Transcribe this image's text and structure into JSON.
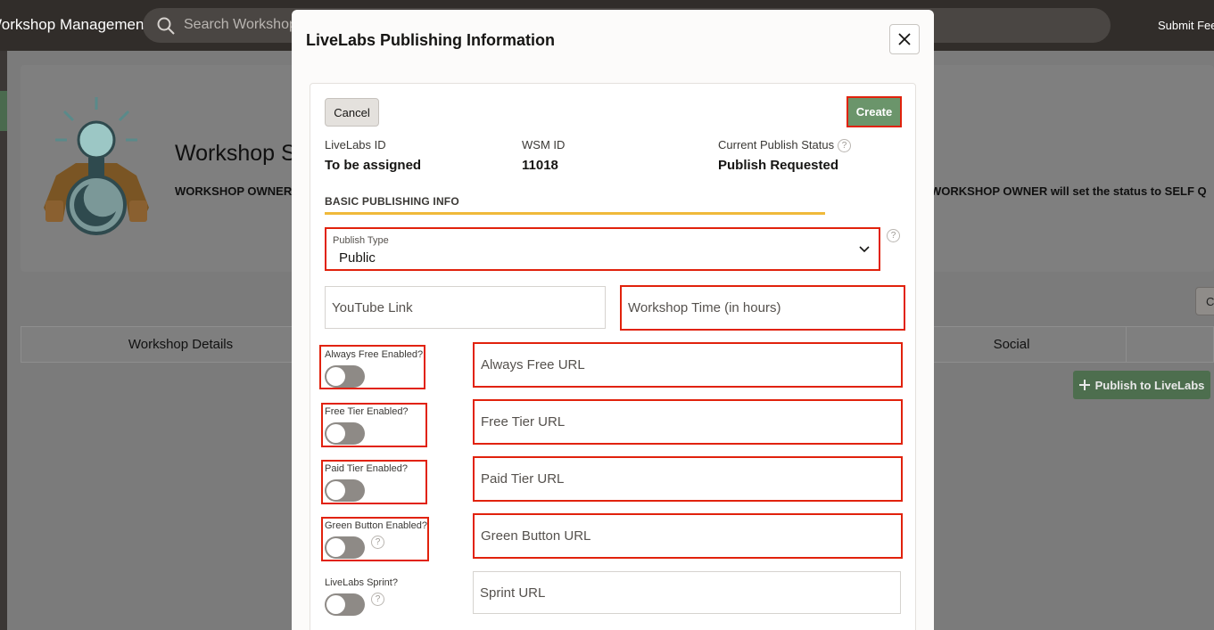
{
  "topbar": {
    "app_title": "Workshop Management System",
    "search_placeholder": "Search Workshops",
    "submit_feedback": "Submit Feedback"
  },
  "hero": {
    "title": "Workshop Status",
    "text_left": "WORKSHOP OWNER",
    "text_right": "WORKSHOP OWNER will set the status to SELF Q"
  },
  "background": {
    "tabs": [
      "Workshop Details",
      "Social"
    ],
    "right_button": "C",
    "publish_button": "Publish to LiveLabs"
  },
  "dialog": {
    "title": "LiveLabs Publishing Information",
    "cancel_label": "Cancel",
    "create_label": "Create",
    "info": {
      "livelabs_id_label": "LiveLabs ID",
      "livelabs_id_value": "To be assigned",
      "wsm_id_label": "WSM ID",
      "wsm_id_value": "11018",
      "publish_status_label": "Current Publish Status",
      "publish_status_value": "Publish Requested"
    },
    "section_title": "BASIC PUBLISHING INFO",
    "publish_type": {
      "label": "Publish Type",
      "value": "Public"
    },
    "youtube_placeholder": "YouTube Link",
    "workshop_time_placeholder": "Workshop Time (in hours)",
    "toggles": {
      "always_free": {
        "label": "Always Free Enabled?",
        "url_placeholder": "Always Free URL",
        "enabled": false
      },
      "free_tier": {
        "label": "Free Tier Enabled?",
        "url_placeholder": "Free Tier URL",
        "enabled": false
      },
      "paid_tier": {
        "label": "Paid Tier Enabled?",
        "url_placeholder": "Paid Tier URL",
        "enabled": false
      },
      "green_button": {
        "label": "Green Button Enabled?",
        "url_placeholder": "Green Button URL",
        "enabled": false
      },
      "sprint": {
        "label": "LiveLabs Sprint?",
        "url_placeholder": "Sprint URL",
        "enabled": false
      }
    }
  },
  "colors": {
    "highlight": "#e1220c",
    "create_button": "#6b956b",
    "section_bar": "#f0b93a",
    "topbar": "#312d2a"
  },
  "icons": [
    "search-icon",
    "close-icon",
    "help-icon",
    "chevron-down-icon",
    "plus-icon",
    "workshop-logo"
  ]
}
